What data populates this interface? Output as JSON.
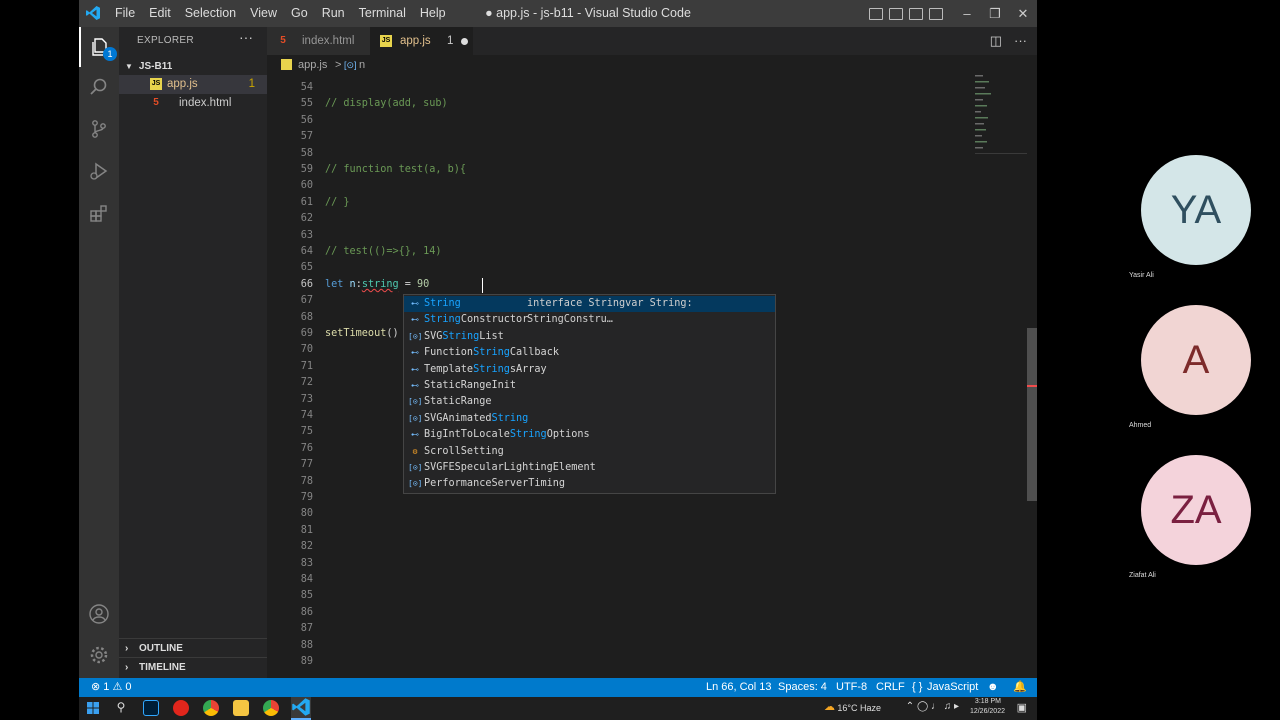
{
  "window": {
    "title": "● app.js - js-b11 - Visual Studio Code",
    "menu": [
      "File",
      "Edit",
      "Selection",
      "View",
      "Go",
      "Run",
      "Terminal",
      "Help"
    ]
  },
  "activity_bar": {
    "explorer_badge": "1"
  },
  "sidebar": {
    "header": "EXPLORER",
    "more": "···",
    "folder": "JS-B11",
    "files": [
      {
        "name": "app.js",
        "count": "1"
      },
      {
        "name": "index.html"
      }
    ],
    "outline": "OUTLINE",
    "timeline": "TIMELINE"
  },
  "tabs": [
    {
      "name": "index.html"
    },
    {
      "name": "app.js",
      "problems": "1"
    }
  ],
  "breadcrumb": {
    "file": "app.js",
    "separator": ">",
    "symbol": "n"
  },
  "editor": {
    "lines": [
      {
        "n": "54",
        "code": ""
      },
      {
        "n": "55",
        "code": "// display(add, sub)"
      },
      {
        "n": "56",
        "code": ""
      },
      {
        "n": "57",
        "code": ""
      },
      {
        "n": "58",
        "code": ""
      },
      {
        "n": "59",
        "code": "// function test(a, b){"
      },
      {
        "n": "60",
        "code": ""
      },
      {
        "n": "61",
        "code": "// }"
      },
      {
        "n": "62",
        "code": ""
      },
      {
        "n": "63",
        "code": ""
      },
      {
        "n": "64",
        "code": "// test(()=>{}, 14)"
      },
      {
        "n": "65",
        "code": ""
      },
      {
        "n": "66",
        "code": "let n:string = 90"
      },
      {
        "n": "67",
        "code": ""
      },
      {
        "n": "68",
        "code": ""
      },
      {
        "n": "69",
        "code": "setTimeout()"
      },
      {
        "n": "70",
        "code": ""
      },
      {
        "n": "71",
        "code": ""
      },
      {
        "n": "72",
        "code": ""
      },
      {
        "n": "73",
        "code": ""
      },
      {
        "n": "74",
        "code": ""
      },
      {
        "n": "75",
        "code": ""
      },
      {
        "n": "76",
        "code": ""
      },
      {
        "n": "77",
        "code": ""
      },
      {
        "n": "78",
        "code": ""
      },
      {
        "n": "79",
        "code": ""
      },
      {
        "n": "80",
        "code": ""
      },
      {
        "n": "81",
        "code": ""
      },
      {
        "n": "82",
        "code": ""
      },
      {
        "n": "83",
        "code": ""
      },
      {
        "n": "84",
        "code": ""
      },
      {
        "n": "85",
        "code": ""
      },
      {
        "n": "86",
        "code": ""
      },
      {
        "n": "87",
        "code": ""
      },
      {
        "n": "88",
        "code": ""
      },
      {
        "n": "89",
        "code": ""
      }
    ]
  },
  "suggestions": [
    {
      "label": "String",
      "kind": "interface",
      "detail": "interface Stringvar String: StringConstru…"
    },
    {
      "label": "StringConstructor",
      "kind": "interface"
    },
    {
      "label": "SVGStringList",
      "kind": "var"
    },
    {
      "label": "FunctionStringCallback",
      "kind": "interface"
    },
    {
      "label": "TemplateStringsArray",
      "kind": "interface"
    },
    {
      "label": "StaticRangeInit",
      "kind": "interface"
    },
    {
      "label": "StaticRange",
      "kind": "var"
    },
    {
      "label": "SVGAnimatedString",
      "kind": "var"
    },
    {
      "label": "BigIntToLocaleStringOptions",
      "kind": "interface"
    },
    {
      "label": "ScrollSetting",
      "kind": "enum"
    },
    {
      "label": "SVGFESpecularLightingElement",
      "kind": "var"
    },
    {
      "label": "PerformanceServerTiming",
      "kind": "var"
    }
  ],
  "statusbar": {
    "errors": "1",
    "warnings": "0",
    "position": "Ln 66, Col 13",
    "spaces": "Spaces: 4",
    "encoding": "UTF-8",
    "eol": "CRLF",
    "language": "JavaScript"
  },
  "taskbar": {
    "weather": "16°C Haze",
    "time": "3:18 PM",
    "date": "12/26/2022"
  },
  "participants": [
    {
      "initials": "YA",
      "name": "Yasir Ali",
      "bg": "#d4e6e8",
      "fg": "#2f4f5f"
    },
    {
      "initials": "A",
      "name": "Ahmed",
      "bg": "#f1d5d3",
      "fg": "#7d2b2b"
    },
    {
      "initials": "ZA",
      "name": "Ziafat Ali",
      "bg": "#f4d3db",
      "fg": "#7a2040"
    }
  ],
  "colors": {
    "accent": "#007acc",
    "editor_bg": "#1e1e1e",
    "sidebar_bg": "#252526"
  }
}
